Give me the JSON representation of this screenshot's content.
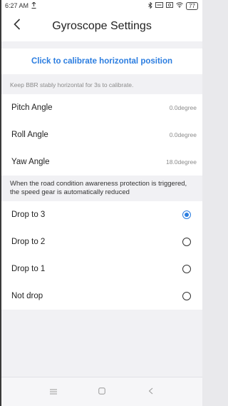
{
  "status_bar": {
    "time": "6:27 AM",
    "upload_icon": "upload-arrow-icon",
    "icons": [
      "bluetooth-icon",
      "sim-icon",
      "nfc-icon",
      "wifi-icon"
    ],
    "battery": "77"
  },
  "header": {
    "title": "Gyroscope Settings",
    "back_icon": "chevron-left-icon"
  },
  "calibration": {
    "button_label": "Click to calibrate horizontal position",
    "hint": "Keep BBR stably horizontal for 3s to calibrate."
  },
  "angles": [
    {
      "label": "Pitch Angle",
      "value": "0.0degree"
    },
    {
      "label": "Roll Angle",
      "value": "0.0degree"
    },
    {
      "label": "Yaw Angle",
      "value": "18.0degree"
    }
  ],
  "speed_note": "When the road condition awareness protection is triggered, the speed gear is automatically reduced",
  "options": [
    {
      "label": "Drop to 3",
      "selected": true
    },
    {
      "label": "Drop to 2",
      "selected": false
    },
    {
      "label": "Drop to 1",
      "selected": false
    },
    {
      "label": "Not drop",
      "selected": false
    }
  ],
  "colors": {
    "accent": "#2b7de0",
    "background": "#f1f1f4"
  }
}
